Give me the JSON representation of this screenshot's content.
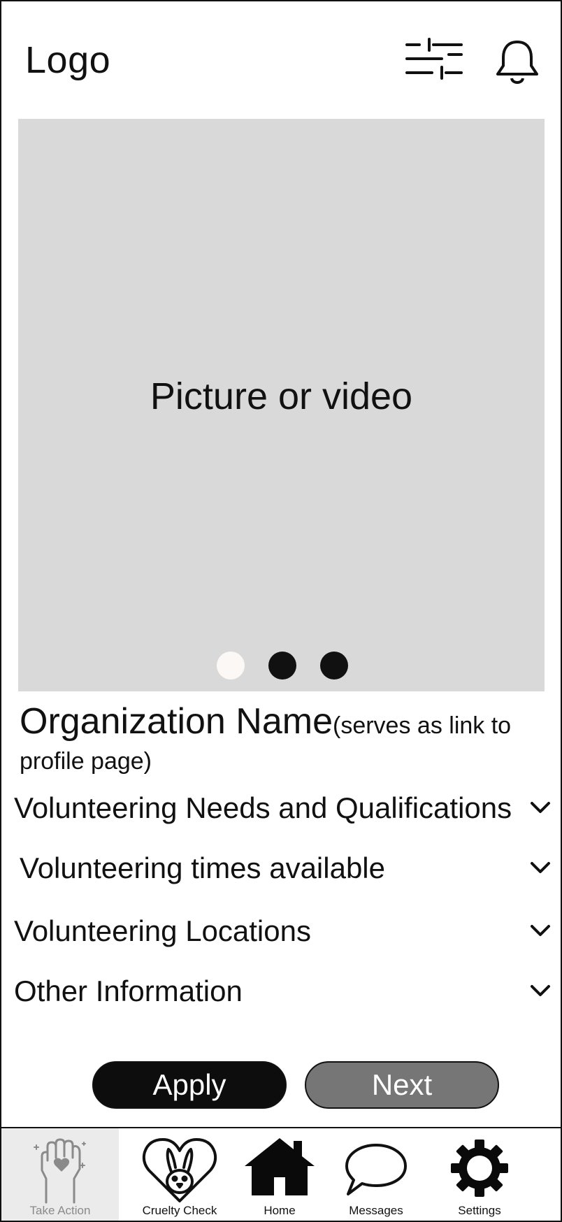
{
  "header": {
    "logo_text": "Logo",
    "filter_icon": "sliders-icon",
    "notification_icon": "bell-icon"
  },
  "media": {
    "caption": "Picture or video",
    "slides": 3,
    "active_slide": 1
  },
  "organization": {
    "name": "Organization Name",
    "note": "(serves as link to profile page)"
  },
  "sections": [
    {
      "label": "Volunteering Needs and Qualifications"
    },
    {
      "label": "Volunteering times available"
    },
    {
      "label": "Volunteering Locations"
    },
    {
      "label": "Other Information"
    }
  ],
  "actions": {
    "apply_label": "Apply",
    "next_label": "Next"
  },
  "nav": {
    "active": "Take Action",
    "items": [
      {
        "label": "Take Action",
        "icon": "raised-fist-heart-icon"
      },
      {
        "label": "Cruelty Check",
        "icon": "bunny-heart-icon"
      },
      {
        "label": "Home",
        "icon": "home-icon"
      },
      {
        "label": "Messages",
        "icon": "speech-bubble-icon"
      },
      {
        "label": "Settings",
        "icon": "gear-icon"
      }
    ]
  },
  "colors": {
    "media_background": "#d9d9d9",
    "apply_button": "#0d0d0d",
    "next_button": "#767676",
    "active_nav_background": "#ebebeb"
  }
}
